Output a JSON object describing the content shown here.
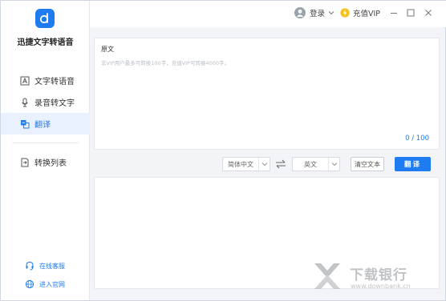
{
  "app": {
    "title": "迅捷文字转语音"
  },
  "titlebar": {
    "login_label": "登录",
    "vip_label": "充值VIP",
    "icons": [
      "user-avatar-icon",
      "chevron-down-icon",
      "vip-bolt-icon",
      "minimize-icon",
      "maximize-icon",
      "close-icon"
    ]
  },
  "sidebar": {
    "items": [
      {
        "label": "文字转语音",
        "icon": "text-to-speech-icon",
        "active": false
      },
      {
        "label": "录音转文字",
        "icon": "microphone-icon",
        "active": false
      },
      {
        "label": "翻译",
        "icon": "translate-icon",
        "active": true
      }
    ],
    "list_item": {
      "label": "转换列表",
      "icon": "convert-list-icon"
    },
    "bottom": [
      {
        "label": "在线客服",
        "icon": "headset-icon"
      },
      {
        "label": "进入官网",
        "icon": "globe-icon"
      }
    ]
  },
  "source_panel": {
    "label": "原文",
    "placeholder": "非VIP用户最多可转换100字，充值VIP可转换4000字。",
    "count": "0 / 100"
  },
  "controls": {
    "source_lang": "简体中文",
    "target_lang": "英文",
    "clear_label": "清空文本",
    "translate_label": "翻译"
  },
  "watermark": {
    "title": "下载银行",
    "url": "www.downbank.cn"
  },
  "colors": {
    "accent": "#1e7bf0",
    "active_bg": "#e8f1fd",
    "background": "#f2f4f8"
  }
}
